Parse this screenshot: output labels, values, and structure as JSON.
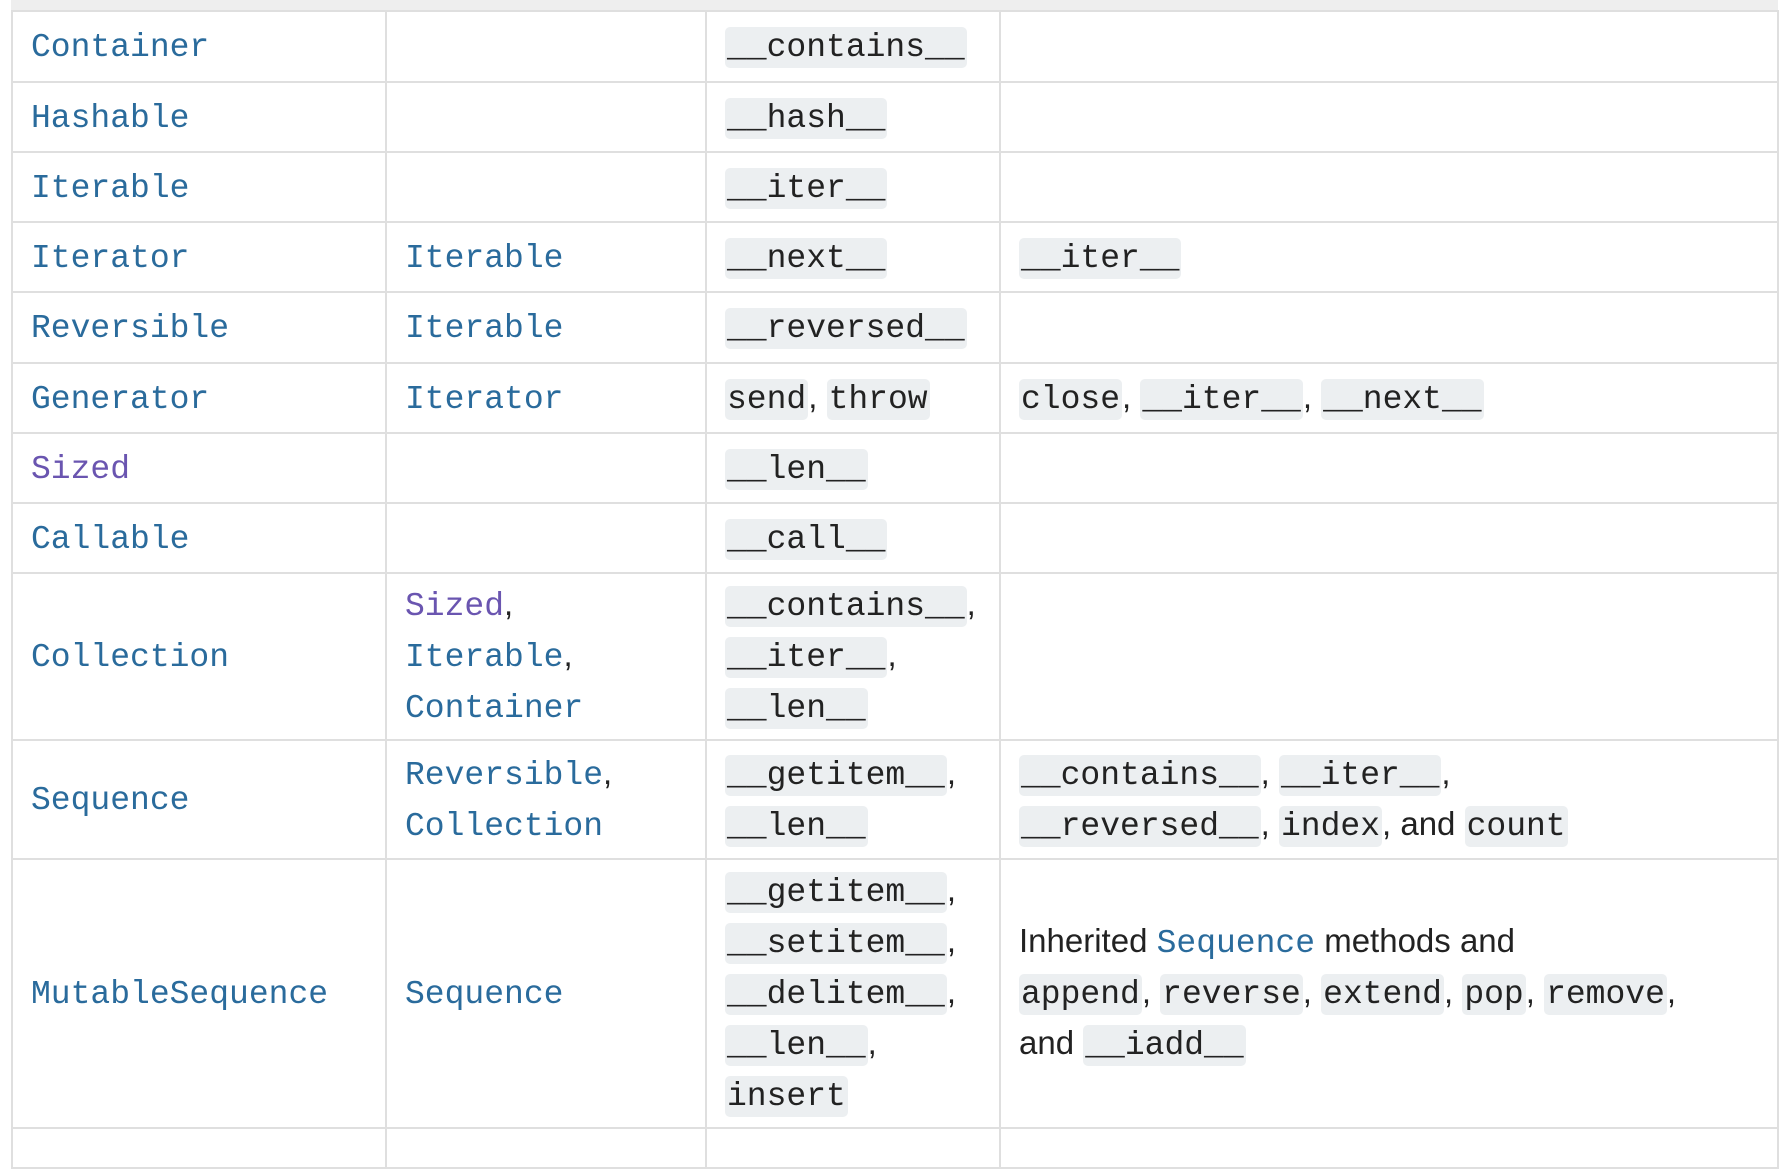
{
  "colors": {
    "link": "#2a6b9c",
    "visited_link": "#6a55b0",
    "code_bg": "#eceff1",
    "border": "#dfdfdf"
  },
  "rows": [
    {
      "cells": [
        [
          {
            "t": "Container",
            "k": "link"
          }
        ],
        [],
        [
          {
            "t": "__contains__",
            "k": "code"
          }
        ],
        []
      ]
    },
    {
      "cells": [
        [
          {
            "t": "Hashable",
            "k": "link"
          }
        ],
        [],
        [
          {
            "t": "__hash__",
            "k": "code"
          }
        ],
        []
      ]
    },
    {
      "cells": [
        [
          {
            "t": "Iterable",
            "k": "link"
          }
        ],
        [],
        [
          {
            "t": "__iter__",
            "k": "code"
          }
        ],
        []
      ]
    },
    {
      "cells": [
        [
          {
            "t": "Iterator",
            "k": "link"
          }
        ],
        [
          {
            "t": "Iterable",
            "k": "link"
          }
        ],
        [
          {
            "t": "__next__",
            "k": "code"
          }
        ],
        [
          {
            "t": "__iter__",
            "k": "code"
          }
        ]
      ]
    },
    {
      "cells": [
        [
          {
            "t": "Reversible",
            "k": "link"
          }
        ],
        [
          {
            "t": "Iterable",
            "k": "link"
          }
        ],
        [
          {
            "t": "__reversed__",
            "k": "code"
          }
        ],
        []
      ]
    },
    {
      "cells": [
        [
          {
            "t": "Generator",
            "k": "link"
          }
        ],
        [
          {
            "t": "Iterator",
            "k": "link"
          }
        ],
        [
          {
            "t": "send",
            "k": "code"
          },
          {
            "t": ", ",
            "k": "text"
          },
          {
            "t": "throw",
            "k": "code"
          }
        ],
        [
          {
            "t": "close",
            "k": "code"
          },
          {
            "t": ", ",
            "k": "text"
          },
          {
            "t": "__iter__",
            "k": "code"
          },
          {
            "t": ", ",
            "k": "text"
          },
          {
            "t": "__next__",
            "k": "code"
          }
        ]
      ]
    },
    {
      "cells": [
        [
          {
            "t": "Sized",
            "k": "visited"
          }
        ],
        [],
        [
          {
            "t": "__len__",
            "k": "code"
          }
        ],
        []
      ]
    },
    {
      "cells": [
        [
          {
            "t": "Callable",
            "k": "link"
          }
        ],
        [],
        [
          {
            "t": "__call__",
            "k": "code"
          }
        ],
        []
      ]
    },
    {
      "cells": [
        [
          {
            "t": "Collection",
            "k": "link"
          }
        ],
        [
          {
            "t": "Sized",
            "k": "visited"
          },
          {
            "t": ",",
            "k": "text"
          },
          {
            "br": true
          },
          {
            "t": "Iterable",
            "k": "link"
          },
          {
            "t": ",",
            "k": "text"
          },
          {
            "br": true
          },
          {
            "t": "Container",
            "k": "link"
          }
        ],
        [
          {
            "t": "__contains__",
            "k": "code"
          },
          {
            "t": ",",
            "k": "text"
          },
          {
            "br": true
          },
          {
            "t": "__iter__",
            "k": "code"
          },
          {
            "t": ",",
            "k": "text"
          },
          {
            "br": true
          },
          {
            "t": "__len__",
            "k": "code"
          }
        ],
        []
      ]
    },
    {
      "cells": [
        [
          {
            "t": "Sequence",
            "k": "link"
          }
        ],
        [
          {
            "t": "Reversible",
            "k": "link"
          },
          {
            "t": ",",
            "k": "text"
          },
          {
            "br": true
          },
          {
            "t": "Collection",
            "k": "link"
          }
        ],
        [
          {
            "t": "__getitem__",
            "k": "code"
          },
          {
            "t": ",",
            "k": "text"
          },
          {
            "br": true
          },
          {
            "t": "__len__",
            "k": "code"
          }
        ],
        [
          {
            "t": "__contains__",
            "k": "code"
          },
          {
            "t": ", ",
            "k": "text"
          },
          {
            "t": "__iter__",
            "k": "code"
          },
          {
            "t": ",",
            "k": "text"
          },
          {
            "br": true
          },
          {
            "t": "__reversed__",
            "k": "code"
          },
          {
            "t": ", ",
            "k": "text"
          },
          {
            "t": "index",
            "k": "code"
          },
          {
            "t": ", and ",
            "k": "text"
          },
          {
            "t": "count",
            "k": "code"
          }
        ]
      ]
    },
    {
      "cells": [
        [
          {
            "t": "MutableSequence",
            "k": "link"
          }
        ],
        [
          {
            "t": "Sequence",
            "k": "link"
          }
        ],
        [
          {
            "t": "__getitem__",
            "k": "code"
          },
          {
            "t": ",",
            "k": "text"
          },
          {
            "br": true
          },
          {
            "t": "__setitem__",
            "k": "code"
          },
          {
            "t": ",",
            "k": "text"
          },
          {
            "br": true
          },
          {
            "t": "__delitem__",
            "k": "code"
          },
          {
            "t": ",",
            "k": "text"
          },
          {
            "br": true
          },
          {
            "t": "__len__",
            "k": "code"
          },
          {
            "t": ", ",
            "k": "text"
          },
          {
            "t": "insert",
            "k": "code"
          }
        ],
        [
          {
            "t": "Inherited ",
            "k": "text"
          },
          {
            "t": "Sequence",
            "k": "textlink"
          },
          {
            "t": " methods and",
            "k": "text"
          },
          {
            "br": true
          },
          {
            "t": "append",
            "k": "code"
          },
          {
            "t": ", ",
            "k": "text"
          },
          {
            "t": "reverse",
            "k": "code"
          },
          {
            "t": ", ",
            "k": "text"
          },
          {
            "t": "extend",
            "k": "code"
          },
          {
            "t": ", ",
            "k": "text"
          },
          {
            "t": "pop",
            "k": "code"
          },
          {
            "t": ", ",
            "k": "text"
          },
          {
            "t": "remove",
            "k": "code"
          },
          {
            "t": ",",
            "k": "text"
          },
          {
            "br": true
          },
          {
            "t": "and ",
            "k": "text"
          },
          {
            "t": "__iadd__",
            "k": "code"
          }
        ]
      ]
    }
  ]
}
